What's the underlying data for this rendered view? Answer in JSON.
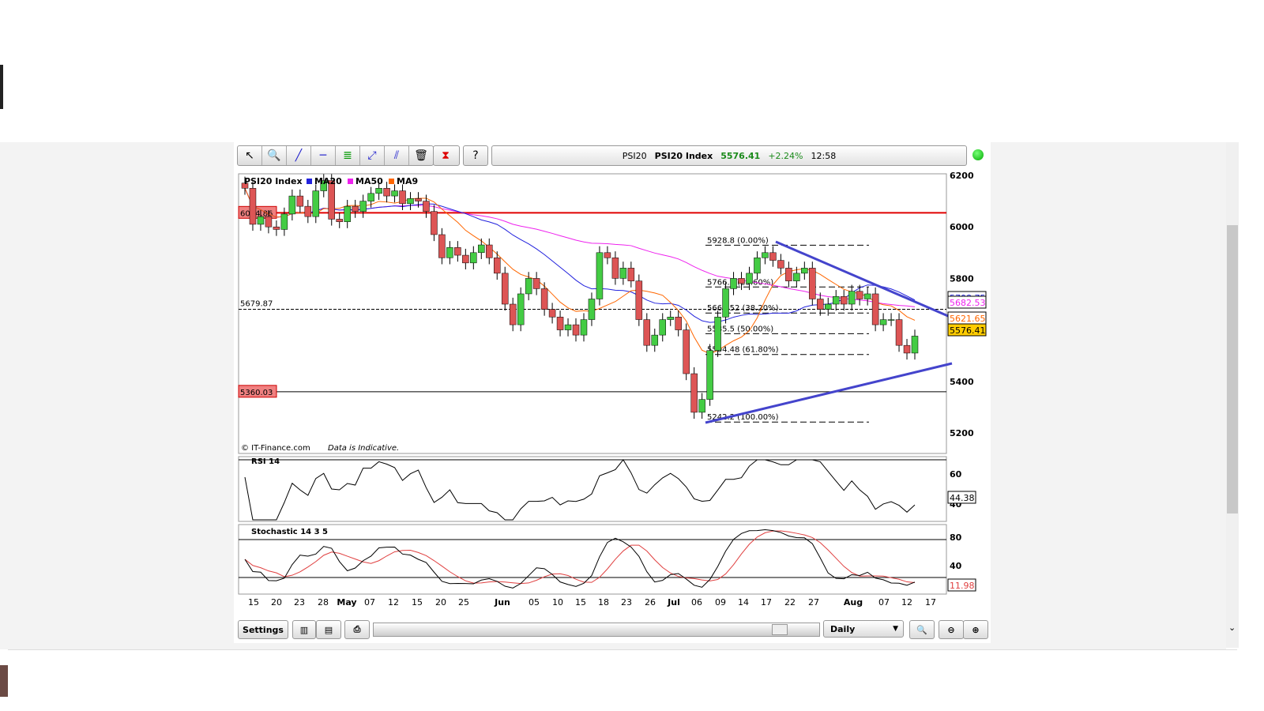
{
  "toolbar": {
    "tools": [
      "pointer-icon",
      "zoom-icon",
      "trendline-icon",
      "horizontal-line-icon",
      "indicators-icon",
      "fibonacci-icon",
      "parallel-lines-icon",
      "trash-icon",
      "chart-type-icon",
      "help-icon"
    ]
  },
  "quote": {
    "symbol": "PSI20",
    "name": "PSI20 Index",
    "price": "5576.41",
    "change": "+2.24%",
    "time": "12:58",
    "up_color": "#1a8a1a"
  },
  "legend": {
    "title": "PSI20 Index",
    "items": [
      {
        "label": "MA20",
        "color": "#2222dd"
      },
      {
        "label": "MA50",
        "color": "#ee22ee"
      },
      {
        "label": "MA9",
        "color": "#ff6600"
      }
    ]
  },
  "main": {
    "yticks": [
      "6200",
      "6000",
      "5800",
      "5400",
      "5200"
    ],
    "hlines": [
      {
        "label": "6054.86",
        "value": 6054.86,
        "color": "#e00000"
      },
      {
        "label": "5679.87",
        "value": 5679.87,
        "color": "#000"
      },
      {
        "label": "5360.03",
        "value": 5360.03,
        "color": "#000"
      }
    ],
    "fib": [
      {
        "label": "5928.8 (0.00%)",
        "value": 5928.8
      },
      {
        "label": "5766.7 (23.60%)",
        "value": 5766.7
      },
      {
        "label": "5665.52 (38.20%)",
        "value": 5665.52
      },
      {
        "label": "5585.5 (50.00%)",
        "value": 5585.5
      },
      {
        "label": "5504.48 (61.80%)",
        "value": 5504.48
      },
      {
        "label": "5242.2 (100.00%)",
        "value": 5242.2
      }
    ],
    "right_labels": [
      {
        "label": "5708.75",
        "color": "#2222dd",
        "bg": "#fff"
      },
      {
        "label": "5682.53",
        "color": "#ee22ee",
        "bg": "#fff"
      },
      {
        "label": "5621.65",
        "color": "#ff6600",
        "bg": "#fff"
      },
      {
        "label": "5576.41",
        "color": "#000",
        "bg": "#ffcc00"
      }
    ],
    "copyright": "© IT-Finance.com",
    "disclaimer": "Data is Indicative."
  },
  "rsi": {
    "title": "RSI 14",
    "ticks": [
      "60",
      "40"
    ],
    "value": "44.38"
  },
  "stoch": {
    "title": "Stochastic 14 3 5",
    "ticks": [
      "80",
      "40"
    ],
    "value": "11.98"
  },
  "xlabels": [
    "15",
    "20",
    "23",
    "28",
    "May",
    "07",
    "12",
    "15",
    "20",
    "25",
    "Jun",
    "05",
    "10",
    "15",
    "18",
    "23",
    "26",
    "Jul",
    "06",
    "09",
    "14",
    "17",
    "22",
    "27",
    "Aug",
    "07",
    "12",
    "17"
  ],
  "bottom": {
    "settings": "Settings",
    "period": "Daily"
  },
  "chart_data": {
    "type": "candlestick",
    "ylim": [
      5200,
      6200
    ],
    "closes": [
      6150,
      6010,
      6040,
      6000,
      5990,
      6050,
      6120,
      6080,
      6040,
      6140,
      6180,
      6030,
      6020,
      6080,
      6060,
      6100,
      6130,
      6150,
      6120,
      6140,
      6090,
      6110,
      6100,
      6060,
      5970,
      5880,
      5920,
      5890,
      5860,
      5900,
      5930,
      5880,
      5820,
      5700,
      5620,
      5740,
      5800,
      5760,
      5680,
      5650,
      5600,
      5620,
      5580,
      5640,
      5720,
      5900,
      5880,
      5800,
      5840,
      5790,
      5640,
      5540,
      5580,
      5640,
      5650,
      5600,
      5430,
      5280,
      5330,
      5520,
      5650,
      5760,
      5800,
      5780,
      5820,
      5880,
      5900,
      5870,
      5840,
      5790,
      5820,
      5840,
      5720,
      5680,
      5700,
      5730,
      5700,
      5750,
      5720,
      5740,
      5620,
      5640,
      5640,
      5540,
      5510,
      5576
    ]
  }
}
